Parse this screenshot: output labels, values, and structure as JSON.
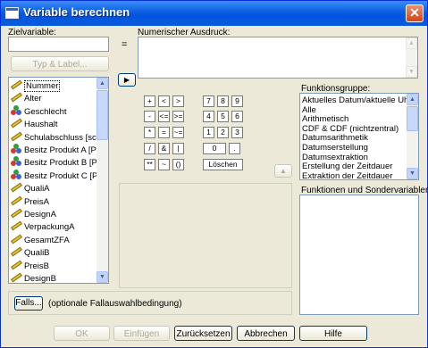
{
  "window": {
    "title": "Variable berechnen",
    "close": "✕"
  },
  "target": {
    "label": "Zielvariable:",
    "value": ""
  },
  "equals": "=",
  "expression": {
    "label": "Numerischer Ausdruck:",
    "value": ""
  },
  "type_label_button": "Typ & Label...",
  "move_arrow": "▶",
  "variables": [
    {
      "name": "Nummer",
      "type": "scale"
    },
    {
      "name": "Alter",
      "type": "scale"
    },
    {
      "name": "Geschlecht",
      "type": "nominal"
    },
    {
      "name": "Haushalt",
      "type": "scale"
    },
    {
      "name": "Schulabschluss [sc",
      "type": "scale"
    },
    {
      "name": "Besitz Produkt A [P",
      "type": "nominal"
    },
    {
      "name": "Besitz Produkt B [P",
      "type": "nominal"
    },
    {
      "name": "Besitz Produkt C [P",
      "type": "nominal"
    },
    {
      "name": "QualiA",
      "type": "scale"
    },
    {
      "name": "PreisA",
      "type": "scale"
    },
    {
      "name": "DesignA",
      "type": "scale"
    },
    {
      "name": "VerpackungA",
      "type": "scale"
    },
    {
      "name": "GesamtZFA",
      "type": "scale"
    },
    {
      "name": "QualiB",
      "type": "scale"
    },
    {
      "name": "PreisB",
      "type": "scale"
    },
    {
      "name": "DesignB",
      "type": "scale"
    }
  ],
  "keypad": [
    [
      {
        "k": "+",
        "w": 13
      },
      {
        "k": "<",
        "w": 13
      },
      {
        "k": ">",
        "w": 13
      },
      {
        "k": "7",
        "w": 13
      },
      {
        "k": "8",
        "w": 13
      },
      {
        "k": "9",
        "w": 13
      }
    ],
    [
      {
        "k": "-",
        "w": 13
      },
      {
        "k": "<=",
        "w": 13
      },
      {
        "k": ">=",
        "w": 13
      },
      {
        "k": "4",
        "w": 13
      },
      {
        "k": "5",
        "w": 13
      },
      {
        "k": "6",
        "w": 13
      }
    ],
    [
      {
        "k": "*",
        "w": 13
      },
      {
        "k": "=",
        "w": 13
      },
      {
        "k": "~=",
        "w": 13
      },
      {
        "k": "1",
        "w": 13
      },
      {
        "k": "2",
        "w": 13
      },
      {
        "k": "3",
        "w": 13
      }
    ],
    [
      {
        "k": "/",
        "w": 13
      },
      {
        "k": "&",
        "w": 13
      },
      {
        "k": "|",
        "w": 13
      },
      {
        "k": "0",
        "w": 26
      },
      {
        "k": ".",
        "w": 13
      }
    ],
    [
      {
        "k": "**",
        "w": 13
      },
      {
        "k": "~",
        "w": 13
      },
      {
        "k": "()",
        "w": 13
      },
      {
        "k": "Löschen",
        "w": 45
      }
    ]
  ],
  "up_arrow": "▲",
  "function_group": {
    "label": "Funktionsgruppe:",
    "items": [
      "Aktuelles Datum/aktuelle Uh",
      "Alle",
      "Arithmetisch",
      "CDF & CDF (nichtzentral)",
      "Datumsarithmetik",
      "Datumserstellung",
      "Datumsextraktion",
      "Erstellung der Zeitdauer",
      "Extraktion der Zeitdauer"
    ]
  },
  "functions_label": "Funktionen und Sondervariablen:",
  "if_button": "Falls...",
  "if_text": "(optionale Fallauswahlbedingung)",
  "buttons": {
    "ok": "OK",
    "paste": "Einfügen",
    "reset": "Zurücksetzen",
    "cancel": "Abbrechen",
    "help": "Hilfe"
  },
  "colors": {
    "title_bar": "#0054e3",
    "dialog_bg": "#ece9d8",
    "input_border": "#7f9db9"
  }
}
